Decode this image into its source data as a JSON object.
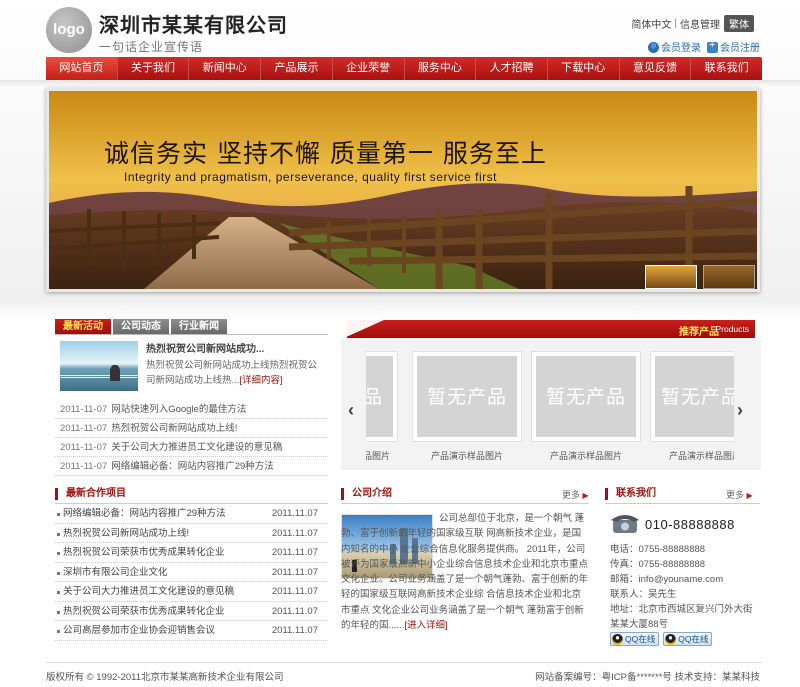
{
  "header": {
    "logo_text": "logo",
    "company_name": "深圳市某某有限公司",
    "slogan": "一句话企业宣传语",
    "lang_simplified": "简体中文",
    "lang_sep": "|",
    "info_manage": "信息管理",
    "lang_traditional": "繁体",
    "member_login": "会员登录",
    "member_register": "会员注册"
  },
  "nav": {
    "items": [
      "网站首页",
      "关于我们",
      "新闻中心",
      "产品展示",
      "企业荣誉",
      "服务中心",
      "人才招聘",
      "下载中心",
      "意见反馈",
      "联系我们"
    ],
    "active": "网站首页"
  },
  "banner": {
    "headline": "诚信务实 坚持不懈 质量第一 服务至上",
    "subline": "Integrity and pragmatism, perseverance, quality first service first"
  },
  "news": {
    "tabs": [
      "最新活动",
      "公司动态",
      "行业新闻"
    ],
    "feature_title": "热烈祝贺公司新网站成功...",
    "feature_desc": "热烈祝贺公司新网站成功上线热烈祝贺公司新网站成功上线热...",
    "feature_more": "[详细内容]",
    "items": [
      {
        "date": "2011-11-07",
        "title": "网站快速列入Google的最佳方法"
      },
      {
        "date": "2011-11-07",
        "title": "热烈祝贺公司新网站成功上线!"
      },
      {
        "date": "2011-11-07",
        "title": "关于公司大力推进员工文化建设的意见稿"
      },
      {
        "date": "2011-11-07",
        "title": "网络编辑必备：网站内容推广29种方法"
      }
    ]
  },
  "products": {
    "title": "推荐产品",
    "title_en": "Products",
    "items": [
      {
        "placeholder": "暂无产品",
        "caption": "产品演示样品图片"
      },
      {
        "placeholder": "暂无产品",
        "caption": "产品演示样品图片"
      },
      {
        "placeholder": "暂无产品",
        "caption": "产品演示样品图片"
      },
      {
        "placeholder": "暂无产品",
        "caption": "产品演示样品图片"
      }
    ],
    "prev_arrow": "‹",
    "next_arrow": "›"
  },
  "cooperation": {
    "title": "最新合作项目",
    "items": [
      {
        "title": "网络编辑必备：网站内容推广29种方法",
        "date": "2011.11.07"
      },
      {
        "title": "热烈祝贺公司新网站成功上线!",
        "date": "2011.11.07"
      },
      {
        "title": "热烈祝贺公司荣获市优秀成果转化企业",
        "date": "2011.11.07"
      },
      {
        "title": "深圳市有限公司企业文化",
        "date": "2011.11.07"
      },
      {
        "title": "关于公司大力推进员工文化建设的意见稿",
        "date": "2011.11.07"
      },
      {
        "title": "热烈祝贺公司荣获市优秀成果转化企业",
        "date": "2011.11.07"
      },
      {
        "title": "公司高层参加市企业协会迎销售会议",
        "date": "2011.11.07"
      }
    ]
  },
  "about": {
    "title": "公司介绍",
    "more": "更多",
    "text": "公司总部位于北京，是一个朝气 蓬勃、富于创新的年轻的国家级互联 网高新技术企业，是国内知名的中小 企业综合信息化服务提供商。 2011年，公司被评为国家级高新中小企业综合信息技术企业和北京市重点 文化企业。公司业务涵盖了是一个朝气蓬勃、富于创新的年轻的国家级互联网高新技术企业综 合信息技术企业和北京市重点 文化企业公司业务涵盖了是一个朝气 蓬勃富于创新的年轻的国......",
    "text_more": "[进入详细]"
  },
  "contact": {
    "title": "联系我们",
    "more": "更多",
    "phone_big": "010-88888888",
    "lines": [
      "电话：0755-88888888",
      "传真：0755-88888888",
      "邮箱：info@youname.com",
      "联系人：吴先生",
      "地址：北京市西城区复兴门外大街某某大厦88号"
    ],
    "qq_buttons": [
      "QQ在线",
      "QQ在线"
    ]
  },
  "footer": {
    "copyright": "版权所有 © 1992-2011北京市某某高新技术企业有限公司",
    "icp": "网站备案编号：粤ICP备*******号 技术支持：某某科技"
  }
}
